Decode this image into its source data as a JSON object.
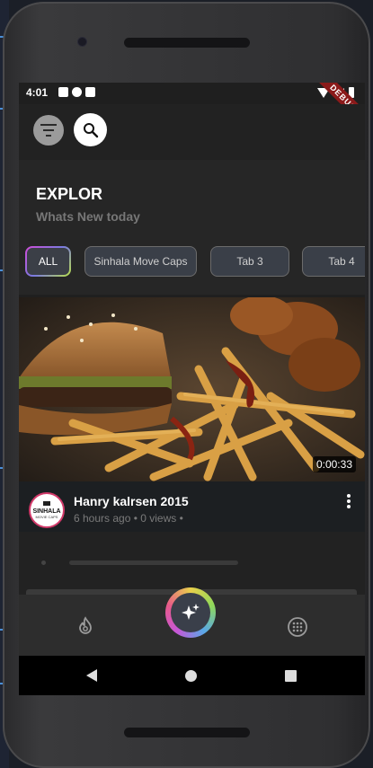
{
  "status_bar": {
    "time": "4:01",
    "debug_label": "DEBUG"
  },
  "header": {
    "filter_icon": "filter-icon",
    "search_icon": "search-icon"
  },
  "page": {
    "title": "EXPLOR",
    "subtitle": "Whats New today"
  },
  "tabs": [
    {
      "label": "ALL",
      "active": true
    },
    {
      "label": "Sinhala Move Caps",
      "active": false
    },
    {
      "label": "Tab 3",
      "active": false
    },
    {
      "label": "Tab 4",
      "active": false
    }
  ],
  "video": {
    "duration": "0:00:33",
    "title": "Hanry kalrsen 2015",
    "meta": "6 hours ago • 0 views •",
    "channel_logo_text": "SINHALA MOVIE CAPS"
  },
  "bottom_nav": {
    "left_icon": "fire-icon",
    "center_icon": "sparkle-icon",
    "right_icon": "grid-dots-icon"
  },
  "colors": {
    "accent_gradient": [
      "#d14bd8",
      "#7a7ae0",
      "#b8e04a"
    ],
    "avatar_ring": "#d23a6a"
  }
}
